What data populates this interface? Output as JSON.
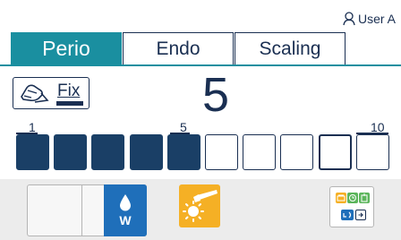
{
  "header": {
    "user_label": "User A",
    "user_icon": "user-outline-icon"
  },
  "tabs": [
    {
      "label": "Perio",
      "active": true
    },
    {
      "label": "Endo",
      "active": false
    },
    {
      "label": "Scaling",
      "active": false
    }
  ],
  "fix_button": {
    "label": "Fix",
    "icon": "foot-control-icon"
  },
  "level": {
    "value": "5",
    "current": 5,
    "max": 10
  },
  "scale_labels": {
    "min": "1",
    "mid": "5",
    "max": "10"
  },
  "bottom": {
    "water_label": "W",
    "water_icon": "water-drop-icon",
    "light_icon": "handpiece-light-icon",
    "mode_icons": [
      "settings-icon",
      "timer-icon",
      "program-icon",
      "reverse-icon",
      "enter-icon"
    ]
  },
  "colors": {
    "accent": "#1a8fa0",
    "level_fill": "#1a3f66",
    "water": "#1f6fba",
    "light": "#f5b025"
  }
}
